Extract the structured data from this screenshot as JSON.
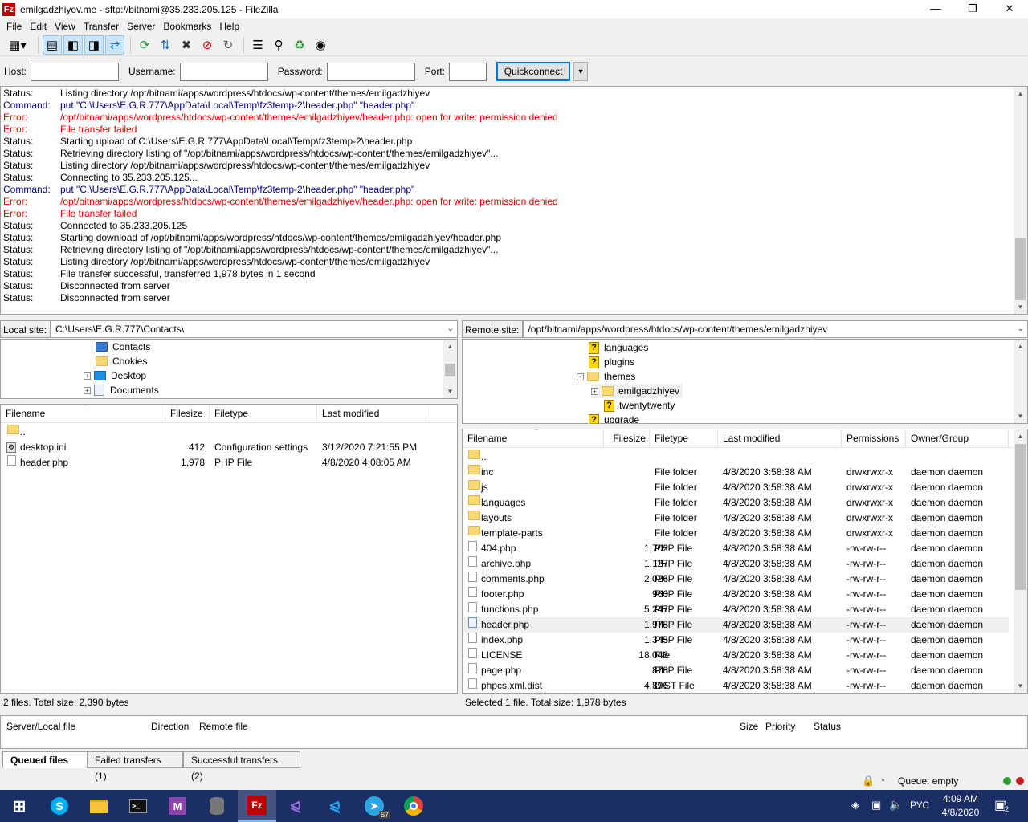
{
  "window": {
    "title": "emilgadzhiyev.me - sftp://bitnami@35.233.205.125 - FileZilla",
    "app_icon": "Fz"
  },
  "menu": [
    "File",
    "Edit",
    "View",
    "Transfer",
    "Server",
    "Bookmarks",
    "Help"
  ],
  "quickconnect": {
    "host_label": "Host:",
    "host_value": "",
    "username_label": "Username:",
    "username_value": "",
    "password_label": "Password:",
    "password_value": "",
    "port_label": "Port:",
    "port_value": "",
    "button_label": "Quickconnect"
  },
  "log": [
    {
      "type": "Status:",
      "msg": "Listing directory /opt/bitnami/apps/wordpress/htdocs/wp-content/themes/emilgadzhiyev",
      "kind": "status"
    },
    {
      "type": "Command:",
      "msg": "put \"C:\\Users\\E.G.R.777\\AppData\\Local\\Temp\\fz3temp-2\\header.php\" \"header.php\"",
      "kind": "cmd"
    },
    {
      "type": "Error:",
      "msg": "/opt/bitnami/apps/wordpress/htdocs/wp-content/themes/emilgadzhiyev/header.php: open for write: permission denied",
      "kind": "err"
    },
    {
      "type": "Error:",
      "msg": "File transfer failed",
      "kind": "err"
    },
    {
      "type": "Status:",
      "msg": "Starting upload of C:\\Users\\E.G.R.777\\AppData\\Local\\Temp\\fz3temp-2\\header.php",
      "kind": "status"
    },
    {
      "type": "Status:",
      "msg": "Retrieving directory listing of \"/opt/bitnami/apps/wordpress/htdocs/wp-content/themes/emilgadzhiyev\"...",
      "kind": "status"
    },
    {
      "type": "Status:",
      "msg": "Listing directory /opt/bitnami/apps/wordpress/htdocs/wp-content/themes/emilgadzhiyev",
      "kind": "status"
    },
    {
      "type": "Status:",
      "msg": "Connecting to 35.233.205.125...",
      "kind": "status"
    },
    {
      "type": "Command:",
      "msg": "put \"C:\\Users\\E.G.R.777\\AppData\\Local\\Temp\\fz3temp-2\\header.php\" \"header.php\"",
      "kind": "cmd"
    },
    {
      "type": "Error:",
      "msg": "/opt/bitnami/apps/wordpress/htdocs/wp-content/themes/emilgadzhiyev/header.php: open for write: permission denied",
      "kind": "err"
    },
    {
      "type": "Error:",
      "msg": "File transfer failed",
      "kind": "err"
    },
    {
      "type": "Status:",
      "msg": "Connected to 35.233.205.125",
      "kind": "status"
    },
    {
      "type": "Status:",
      "msg": "Starting download of /opt/bitnami/apps/wordpress/htdocs/wp-content/themes/emilgadzhiyev/header.php",
      "kind": "status"
    },
    {
      "type": "Status:",
      "msg": "Retrieving directory listing of \"/opt/bitnami/apps/wordpress/htdocs/wp-content/themes/emilgadzhiyev\"...",
      "kind": "status"
    },
    {
      "type": "Status:",
      "msg": "Listing directory /opt/bitnami/apps/wordpress/htdocs/wp-content/themes/emilgadzhiyev",
      "kind": "status"
    },
    {
      "type": "Status:",
      "msg": "File transfer successful, transferred 1,978 bytes in 1 second",
      "kind": "status"
    },
    {
      "type": "Status:",
      "msg": "Disconnected from server",
      "kind": "status"
    },
    {
      "type": "Status:",
      "msg": "Disconnected from server",
      "kind": "status"
    }
  ],
  "local": {
    "site_label": "Local site:",
    "path": "C:\\Users\\E.G.R.777\\Contacts\\",
    "tree": [
      {
        "name": "Contacts",
        "icon": "contacts-folder",
        "expander": ""
      },
      {
        "name": "Cookies",
        "icon": "folder",
        "expander": ""
      },
      {
        "name": "Desktop",
        "icon": "desktop-folder",
        "expander": "+"
      },
      {
        "name": "Documents",
        "icon": "documents-folder",
        "expander": "+"
      }
    ],
    "columns": [
      "Filename",
      "Filesize",
      "Filetype",
      "Last modified"
    ],
    "files": [
      {
        "name": "..",
        "size": "",
        "type": "",
        "modified": "",
        "icon": "folder"
      },
      {
        "name": "desktop.ini",
        "size": "412",
        "type": "Configuration settings",
        "modified": "3/12/2020 7:21:55 PM",
        "icon": "settings-file"
      },
      {
        "name": "header.php",
        "size": "1,978",
        "type": "PHP File",
        "modified": "4/8/2020 4:08:05 AM",
        "icon": "file"
      }
    ],
    "status": "2 files. Total size: 2,390 bytes"
  },
  "remote": {
    "site_label": "Remote site:",
    "path": "/opt/bitnami/apps/wordpress/htdocs/wp-content/themes/emilgadzhiyev",
    "tree": [
      {
        "name": "languages",
        "icon": "unknown-folder",
        "expander": ""
      },
      {
        "name": "plugins",
        "icon": "unknown-folder",
        "expander": ""
      },
      {
        "name": "themes",
        "icon": "folder",
        "expander": "-"
      },
      {
        "name": "emilgadzhiyev",
        "icon": "folder",
        "expander": "+"
      },
      {
        "name": "twentytwenty",
        "icon": "unknown-folder",
        "expander": ""
      },
      {
        "name": "upgrade",
        "icon": "unknown-folder",
        "expander": ""
      }
    ],
    "columns": [
      "Filename",
      "Filesize",
      "Filetype",
      "Last modified",
      "Permissions",
      "Owner/Group"
    ],
    "files": [
      {
        "name": "..",
        "size": "",
        "type": "",
        "modified": "",
        "perm": "",
        "owner": "",
        "icon": "folder"
      },
      {
        "name": "inc",
        "size": "",
        "type": "File folder",
        "modified": "4/8/2020 3:58:38 AM",
        "perm": "drwxrwxr-x",
        "owner": "daemon daemon",
        "icon": "folder"
      },
      {
        "name": "js",
        "size": "",
        "type": "File folder",
        "modified": "4/8/2020 3:58:38 AM",
        "perm": "drwxrwxr-x",
        "owner": "daemon daemon",
        "icon": "folder"
      },
      {
        "name": "languages",
        "size": "",
        "type": "File folder",
        "modified": "4/8/2020 3:58:38 AM",
        "perm": "drwxrwxr-x",
        "owner": "daemon daemon",
        "icon": "folder"
      },
      {
        "name": "layouts",
        "size": "",
        "type": "File folder",
        "modified": "4/8/2020 3:58:38 AM",
        "perm": "drwxrwxr-x",
        "owner": "daemon daemon",
        "icon": "folder"
      },
      {
        "name": "template-parts",
        "size": "",
        "type": "File folder",
        "modified": "4/8/2020 3:58:38 AM",
        "perm": "drwxrwxr-x",
        "owner": "daemon daemon",
        "icon": "folder"
      },
      {
        "name": "404.php",
        "size": "1,702",
        "type": "PHP File",
        "modified": "4/8/2020 3:58:38 AM",
        "perm": "-rw-rw-r--",
        "owner": "daemon daemon",
        "icon": "file"
      },
      {
        "name": "archive.php",
        "size": "1,127",
        "type": "PHP File",
        "modified": "4/8/2020 3:58:38 AM",
        "perm": "-rw-rw-r--",
        "owner": "daemon daemon",
        "icon": "file"
      },
      {
        "name": "comments.php",
        "size": "2,026",
        "type": "PHP File",
        "modified": "4/8/2020 3:58:38 AM",
        "perm": "-rw-rw-r--",
        "owner": "daemon daemon",
        "icon": "file"
      },
      {
        "name": "footer.php",
        "size": "960",
        "type": "PHP File",
        "modified": "4/8/2020 3:58:38 AM",
        "perm": "-rw-rw-r--",
        "owner": "daemon daemon",
        "icon": "file"
      },
      {
        "name": "functions.php",
        "size": "5,247",
        "type": "PHP File",
        "modified": "4/8/2020 3:58:38 AM",
        "perm": "-rw-rw-r--",
        "owner": "daemon daemon",
        "icon": "file"
      },
      {
        "name": "header.php",
        "size": "1,978",
        "type": "PHP File",
        "modified": "4/8/2020 3:58:38 AM",
        "perm": "-rw-rw-r--",
        "owner": "daemon daemon",
        "icon": "php-file",
        "selected": true
      },
      {
        "name": "index.php",
        "size": "1,345",
        "type": "PHP File",
        "modified": "4/8/2020 3:58:38 AM",
        "perm": "-rw-rw-r--",
        "owner": "daemon daemon",
        "icon": "file"
      },
      {
        "name": "LICENSE",
        "size": "18,046",
        "type": "File",
        "modified": "4/8/2020 3:58:38 AM",
        "perm": "-rw-rw-r--",
        "owner": "daemon daemon",
        "icon": "file"
      },
      {
        "name": "page.php",
        "size": "878",
        "type": "PHP File",
        "modified": "4/8/2020 3:58:38 AM",
        "perm": "-rw-rw-r--",
        "owner": "daemon daemon",
        "icon": "file"
      },
      {
        "name": "phpcs.xml.dist",
        "size": "4,896",
        "type": "DIST File",
        "modified": "4/8/2020 3:58:38 AM",
        "perm": "-rw-rw-r--",
        "owner": "daemon daemon",
        "icon": "file"
      }
    ],
    "status": "Selected 1 file. Total size: 1,978 bytes"
  },
  "queue": {
    "columns": [
      "Server/Local file",
      "Direction",
      "Remote file",
      "Size",
      "Priority",
      "Status"
    ],
    "tabs": [
      {
        "label": "Queued files",
        "active": true
      },
      {
        "label": "Failed transfers (1)",
        "active": false
      },
      {
        "label": "Successful transfers (2)",
        "active": false
      }
    ],
    "status": "Queue: empty"
  },
  "taskbar": {
    "apps": [
      "windows-start-icon",
      "skype-icon",
      "file-explorer-icon",
      "terminal-icon",
      "markdown-editor-icon",
      "database-icon",
      "filezilla-icon",
      "visual-studio-icon",
      "vscode-icon",
      "telegram-icon",
      "chrome-icon"
    ],
    "telegram_badge": "67",
    "language": "РУС",
    "time": "4:09 AM",
    "date": "4/8/2020",
    "notifications": "2"
  }
}
